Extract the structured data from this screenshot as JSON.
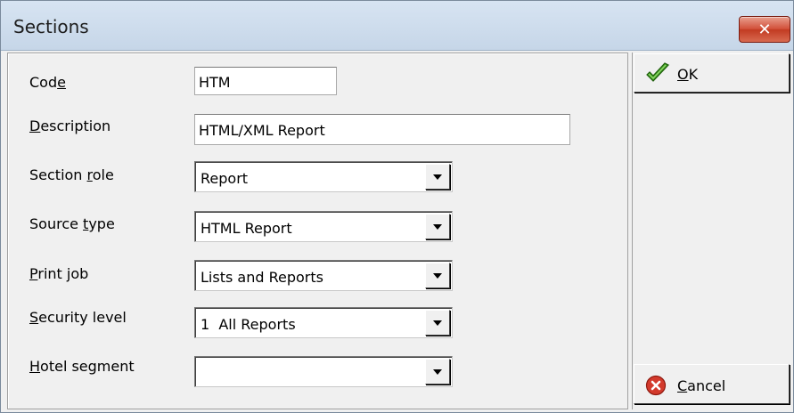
{
  "window": {
    "title": "Sections",
    "close_glyph": "✕"
  },
  "fields": {
    "code": {
      "label_pre": "Cod",
      "label_u": "e",
      "label_post": "",
      "value": "HTM"
    },
    "description": {
      "label_pre": "",
      "label_u": "D",
      "label_post": "escription",
      "value": "HTML/XML Report"
    },
    "section_role": {
      "label_pre": "Section ",
      "label_u": "r",
      "label_post": "ole",
      "value": "Report"
    },
    "source_type": {
      "label_pre": "Source ",
      "label_u": "t",
      "label_post": "ype",
      "value": "HTML Report"
    },
    "print_job": {
      "label_pre": "",
      "label_u": "P",
      "label_post": "rint job",
      "value": "Lists and Reports"
    },
    "security_level": {
      "label_pre": "",
      "label_u": "S",
      "label_post": "ecurity level",
      "value": "1  All Reports"
    },
    "hotel_segment": {
      "label_pre": "",
      "label_u": "H",
      "label_post": "otel segment",
      "value": ""
    }
  },
  "buttons": {
    "ok": {
      "label_u": "O",
      "label_post": "K",
      "icon": "green-checkmark-icon",
      "icon_color": "#3a9a1e"
    },
    "cancel": {
      "label_u": "C",
      "label_post": "ancel",
      "icon": "red-cancel-icon",
      "icon_color": "#d33a2c"
    }
  }
}
